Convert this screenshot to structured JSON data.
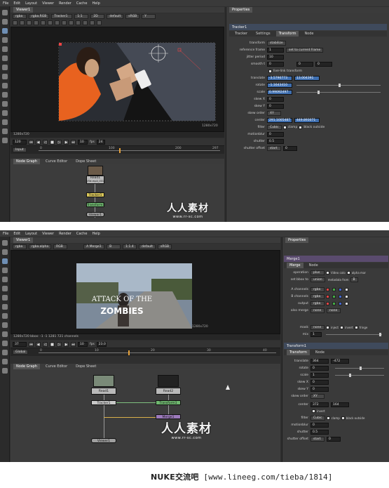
{
  "menu": [
    "File",
    "Edit",
    "Layout",
    "Viewer",
    "Render",
    "Cache",
    "Help"
  ],
  "shot1": {
    "viewer_tab": "Viewer1",
    "viewer_row": {
      "channels": "rgba",
      "layer": "rgba.RGB",
      "node": "Tracker1",
      "zoom": "1:1",
      "mode": "2D",
      "lut": "default",
      "colorspace": "sRGB",
      "aspect": "Y"
    },
    "format_label": "1280x720",
    "format_label_br": "1280x720",
    "frame_field": "120",
    "fps_label": "fps",
    "fps_value": "24",
    "play_count": "10",
    "input_label": "Input",
    "tl_ticks": [
      "0",
      "100",
      "200",
      "297"
    ],
    "node_tabs": [
      "Node Graph",
      "Curve Editor",
      "Dope Sheet"
    ],
    "nodes": {
      "read": "Read1",
      "read_sub": "(file.mp4_001)",
      "tracker": "Tracker1",
      "transform": "Transform1",
      "viewer": "Viewer1"
    },
    "props": {
      "title": "Properties",
      "node": "Tracker1",
      "tabs": [
        "Tracker",
        "Settings",
        "Transform",
        "Node"
      ],
      "rows": [
        {
          "label": "transform",
          "value": "stabilize"
        },
        {
          "label": "reference frame",
          "value": "1",
          "extra": "set to current frame"
        },
        {
          "label": "jitter period",
          "value": "10"
        },
        {
          "label": "smooth t",
          "value": "0",
          "v2": "0",
          "v3": "0"
        },
        {
          "label": "",
          "value": "live-link transform"
        },
        {
          "label": "translate",
          "value": "-3.5790773",
          "v2": "13.004391"
        },
        {
          "label": "rotate",
          "value": "-1.1643410"
        },
        {
          "label": "scale",
          "value": "0.99092497"
        },
        {
          "label": "skew X",
          "value": "0"
        },
        {
          "label": "skew Y",
          "value": "0"
        },
        {
          "label": "skew order",
          "value": "XY"
        },
        {
          "label": "center",
          "value": "291.1005487",
          "v2": "449.893071"
        },
        {
          "label": "filter",
          "value": "Cubic",
          "c1": "clamp",
          "c2": "black outside"
        },
        {
          "label": "motionblur",
          "value": "0"
        },
        {
          "label": "shutter",
          "value": "0.5"
        },
        {
          "label": "shutter offset",
          "value": "start",
          "v2": "0"
        }
      ]
    }
  },
  "shot2": {
    "viewer_tab": "Viewer1",
    "viewer_row": {
      "channels": "rgba",
      "layer": "rgba.alpha",
      "mode": "RGB",
      "node": "A Merge1",
      "b": "B",
      "zoom": "1:1.4",
      "lut": "default",
      "colorspace": "sRGB"
    },
    "format_label": "1280x720",
    "format_label_br": "1280x720",
    "bbox_info": "1280x720 bbox: -1 -1 1281 721 channels",
    "frame_field": "37",
    "play_count": "10",
    "fps_label": "fps",
    "fps_value": "23.0",
    "global_label": "Global",
    "tl_ticks": [
      "0",
      "10",
      "20",
      "30",
      "40"
    ],
    "node_tabs": [
      "Node Graph",
      "Curve Editor",
      "Dope Sheet"
    ],
    "nodes": {
      "read1": "Read1",
      "read2": "Read2",
      "tracker": "Tracker1",
      "transform": "Transform1",
      "merge": "Merge1",
      "viewer": "Viewer1"
    },
    "merge_props": {
      "title": "Properties",
      "tabs": [
        "Merge",
        "Node"
      ],
      "rows": [
        {
          "label": "operation",
          "value": "plus",
          "c1": "Video colo",
          "c2": "alpha mar"
        },
        {
          "label": "set bbox to",
          "value": "union",
          "extra": "metadata from",
          "v2": "B"
        },
        {
          "label": "A channels",
          "value": "rgba"
        },
        {
          "label": "B channels",
          "value": "rgba"
        },
        {
          "label": "output",
          "value": "rgba"
        },
        {
          "label": "also merge",
          "value": "none",
          "v2": "none"
        },
        {
          "label": "mask",
          "value": "none",
          "c1": "inject",
          "c2": "invert",
          "c3": "fringe"
        },
        {
          "label": "mix",
          "value": "1"
        }
      ]
    },
    "transform_props": {
      "tabs": [
        "Transform",
        "Node"
      ],
      "rows": [
        {
          "label": "translate",
          "value": "364",
          "v2": "-472"
        },
        {
          "label": "rotate",
          "value": "0"
        },
        {
          "label": "scale",
          "value": "1"
        },
        {
          "label": "skew X",
          "value": "0"
        },
        {
          "label": "skew Y",
          "value": "0"
        },
        {
          "label": "skew order",
          "value": "XY"
        },
        {
          "label": "center",
          "value": "372",
          "v2": "164"
        },
        {
          "label": "",
          "value": "invert"
        },
        {
          "label": "filter",
          "value": "Cubic",
          "c1": "clamp",
          "c2": "black outside"
        },
        {
          "label": "motionblur",
          "value": "0"
        },
        {
          "label": "shutter",
          "value": "0.5"
        },
        {
          "label": "shutter offset",
          "value": "start",
          "v2": "0"
        }
      ]
    },
    "zombie_title": "ATTACK OF THE",
    "zombie_word": "ZOMBIES"
  },
  "watermark": {
    "main": "人人素材",
    "sub": "www.rr-sc.com"
  },
  "footer": {
    "left": "NUKE交流吧",
    "right": "[www.lineeg.com/tieba/1814]"
  },
  "colors": {
    "accent": "#3f6fb0",
    "panel": "#3a3a3a",
    "viewer_bg": "#1a1a1a"
  }
}
